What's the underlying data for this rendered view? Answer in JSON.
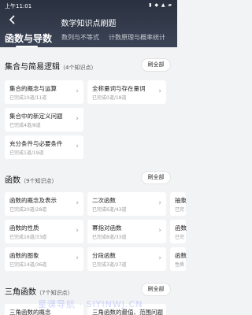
{
  "status": {
    "time": "上午11:01",
    "icons": "▮ ◆ ▲ ▰"
  },
  "header": {
    "back_icon": "back-arrow",
    "title": "数学知识点刷题"
  },
  "tabs": [
    {
      "label": "函数与导数",
      "active": true
    },
    {
      "label": "数列与不等式",
      "active": false
    },
    {
      "label": "计数原理与概率统计",
      "active": false
    }
  ],
  "sections": [
    {
      "title": "集合与简易逻辑",
      "count": "（4个知识点）",
      "all_label": "刷全部",
      "cards": [
        {
          "name": "集合的概念与运算",
          "progress": "已完成10道/11道"
        },
        {
          "name": "全称量词与存在量词",
          "progress": "已完成0道/18道"
        },
        {
          "name": "集合中的新定义问题",
          "progress": "已完成4道/8道"
        },
        {
          "name": "充分条件与必要条件",
          "progress": "已完成1道/19道"
        }
      ]
    },
    {
      "title": "函数",
      "count": "（9个知识点）",
      "all_label": "刷全部",
      "cards": [
        {
          "name": "函数的概念及表示",
          "progress": "已完成20道/28道"
        },
        {
          "name": "二次函数",
          "progress": "已完成6道/43道"
        },
        {
          "name": "抽象",
          "progress": "已完"
        },
        {
          "name": "函数的性质",
          "progress": "已完成16道/33道"
        },
        {
          "name": "幂指对函数",
          "progress": "已完成8道/33道"
        },
        {
          "name": "函数",
          "progress": "已完"
        },
        {
          "name": "函数的图象",
          "progress": "已完成14道/36道"
        },
        {
          "name": "分段函数",
          "progress": "已完成3道/27道"
        },
        {
          "name": "函数",
          "progress": "性质"
        }
      ]
    },
    {
      "title": "三角函数",
      "count": "（7个知识点）",
      "all_label": "刷全部",
      "cards": [
        {
          "name": "三角函数的概念",
          "progress": ""
        },
        {
          "name": "三角函数的最值、范围问题",
          "progress": ""
        }
      ]
    }
  ],
  "watermark": "星课导航 · SIYINWJ.CN"
}
